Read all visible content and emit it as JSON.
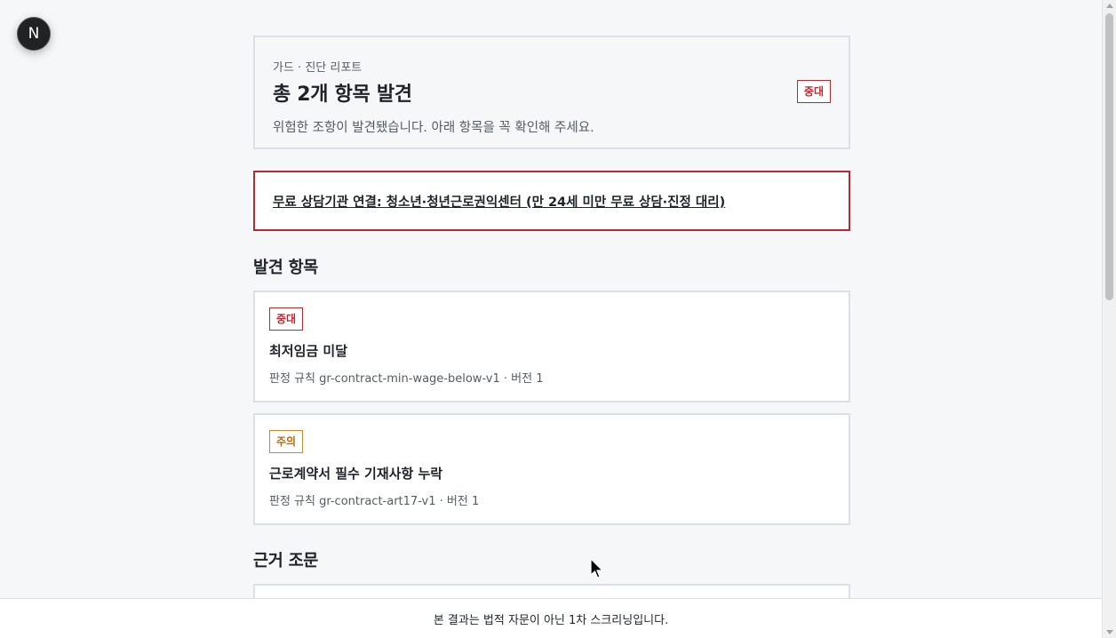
{
  "dev_badge": {
    "letter": "N"
  },
  "summary": {
    "kicker": "가드 · 진단 리포트",
    "title": "총 2개 항목 발견",
    "description": "위험한 조항이 발견됐습니다. 아래 항목을 꼭 확인해 주세요.",
    "severity": "중대"
  },
  "alert": {
    "link_text": "무료 상담기관 연결: 청소년·청년근로권익센터 (만 24세 미만 무료 상담·진정 대리)"
  },
  "findings_section": {
    "title": "발견 항목",
    "items": [
      {
        "severity": "중대",
        "title": "최저임금 미달",
        "rule": "판정 규칙 gr-contract-min-wage-below-v1 · 버전 1"
      },
      {
        "severity": "주의",
        "title": "근로계약서 필수 기재사항 누락",
        "rule": "판정 규칙 gr-contract-art17-v1 · 버전 1"
      }
    ]
  },
  "evidence_section": {
    "title": "근거 조문"
  },
  "footer": {
    "text": "본 결과는 법적 자문이 아닌 1차 스크리닝입니다."
  },
  "colors": {
    "severity_major": "#c0262d",
    "severity_caution": "#b8690d",
    "background": "#f6f7f8"
  }
}
